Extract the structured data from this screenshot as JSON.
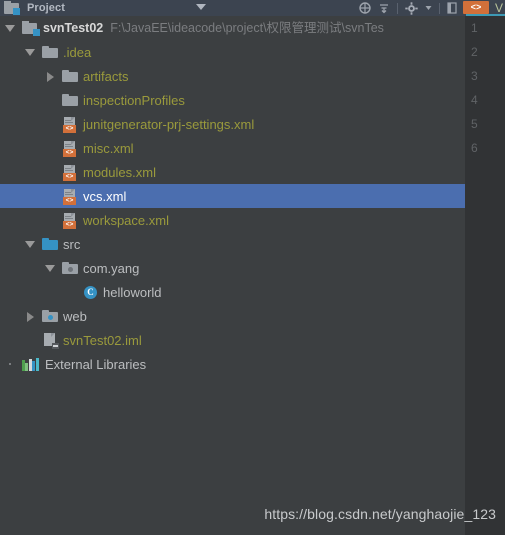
{
  "titlebar": {
    "title": "Project",
    "caret_icon": "chevron-down-icon",
    "icons": [
      "target-scope-icon",
      "collapse-all-icon",
      "settings-gear-icon",
      "hide-panel-icon"
    ],
    "badge_label": "<>",
    "version_mark": "V"
  },
  "tree": {
    "rows": [
      {
        "id": "svnTest02",
        "label": "svnTest02",
        "path": "F:\\JavaEE\\ideacode\\project\\权限管理测试\\svnTes",
        "indent": 0,
        "twisty": "expanded",
        "icon": "project-module-icon",
        "style": "proj",
        "selected": false
      },
      {
        "id": "idea",
        "label": ".idea",
        "path": "",
        "indent": 1,
        "twisty": "expanded",
        "icon": "folder-icon",
        "style": "folder",
        "selected": false
      },
      {
        "id": "artifacts",
        "label": "artifacts",
        "path": "",
        "indent": 2,
        "twisty": "collapsed",
        "icon": "folder-icon",
        "style": "folder",
        "selected": false
      },
      {
        "id": "inspectionProfiles",
        "label": "inspectionProfiles",
        "path": "",
        "indent": 2,
        "twisty": "none",
        "icon": "folder-icon",
        "style": "folder",
        "selected": false
      },
      {
        "id": "junitgenerator",
        "label": "junitgenerator-prj-settings.xml",
        "path": "",
        "indent": 2,
        "twisty": "none",
        "icon": "xml-file-icon",
        "style": "xml",
        "selected": false
      },
      {
        "id": "misc",
        "label": "misc.xml",
        "path": "",
        "indent": 2,
        "twisty": "none",
        "icon": "xml-file-icon",
        "style": "xml",
        "selected": false
      },
      {
        "id": "modules",
        "label": "modules.xml",
        "path": "",
        "indent": 2,
        "twisty": "none",
        "icon": "xml-file-icon",
        "style": "xml",
        "selected": false
      },
      {
        "id": "vcs",
        "label": "vcs.xml",
        "path": "",
        "indent": 2,
        "twisty": "none",
        "icon": "xml-file-icon",
        "style": "xml",
        "selected": true
      },
      {
        "id": "workspace",
        "label": "workspace.xml",
        "path": "",
        "indent": 2,
        "twisty": "none",
        "icon": "xml-file-icon",
        "style": "xml",
        "selected": false
      },
      {
        "id": "src",
        "label": "src",
        "path": "",
        "indent": 1,
        "twisty": "expanded",
        "icon": "source-folder-icon",
        "style": "plain",
        "selected": false
      },
      {
        "id": "com.yang",
        "label": "com.yang",
        "path": "",
        "indent": 2,
        "twisty": "expanded",
        "icon": "package-icon",
        "style": "plain",
        "selected": false
      },
      {
        "id": "helloworld",
        "label": "helloworld",
        "path": "",
        "indent": 3,
        "twisty": "none",
        "icon": "java-class-icon",
        "style": "plain",
        "selected": false
      },
      {
        "id": "web",
        "label": "web",
        "path": "",
        "indent": 1,
        "twisty": "collapsed",
        "icon": "web-folder-icon",
        "style": "plain",
        "selected": false
      },
      {
        "id": "svnTest02.iml",
        "label": "svnTest02.iml",
        "path": "",
        "indent": 1,
        "twisty": "none",
        "icon": "iml-file-icon",
        "style": "iml",
        "selected": false
      },
      {
        "id": "ExternalLibraries",
        "label": "External Libraries",
        "path": "",
        "indent": 0,
        "twisty": "dot",
        "icon": "external-libraries-icon",
        "style": "plain",
        "selected": false
      }
    ]
  },
  "gutter": {
    "line_numbers": [
      "1",
      "2",
      "3",
      "4",
      "5",
      "6"
    ]
  },
  "watermark": {
    "text": "https://blog.csdn.net/yanghaojie_123"
  },
  "colors": {
    "background": "#3c3f41",
    "titlebar": "#3c4450",
    "selection": "#4b6eaf",
    "folder_text": "#9a9a3c",
    "plain_text": "#bcbec0",
    "path_text": "#7b7d80",
    "accent_orange": "#d2703a",
    "accent_blue": "#3592c4",
    "gutter_bg": "#313335"
  }
}
